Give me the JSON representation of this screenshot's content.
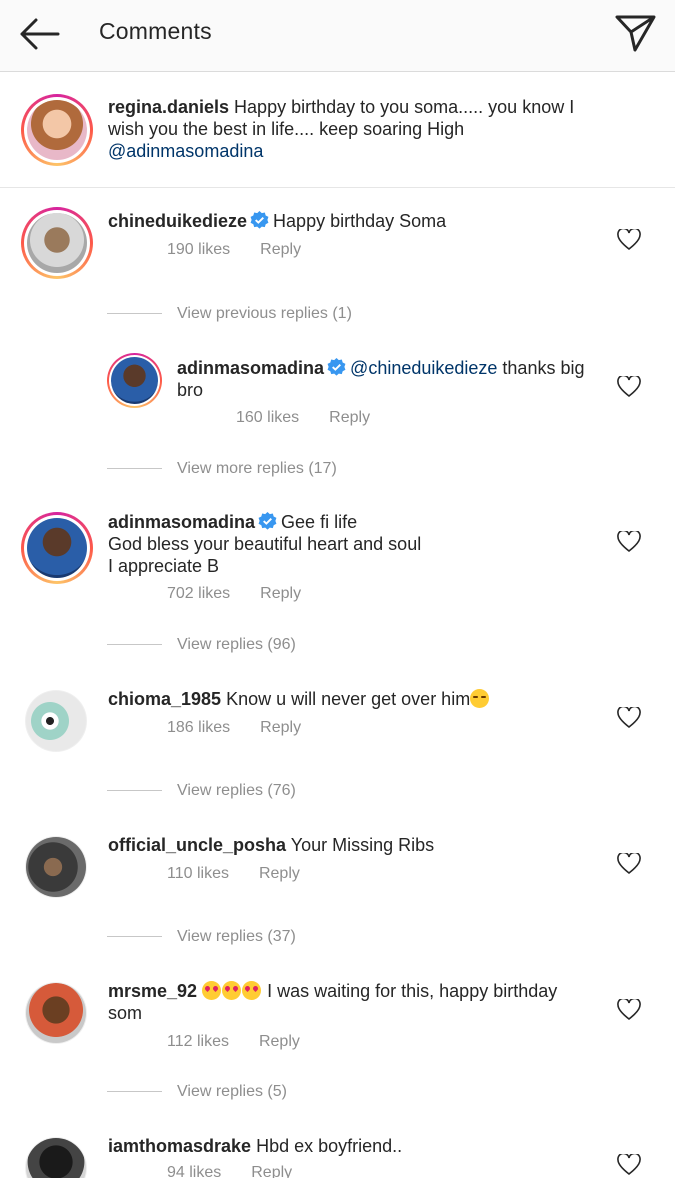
{
  "header": {
    "title": "Comments"
  },
  "caption": {
    "username": "regina.daniels",
    "text": " Happy birthday to you soma..... you know I wish you the best in life.... keep soaring High ",
    "mention": "@adinmasomadina"
  },
  "comments": [
    {
      "username": "chineduikedieze",
      "text": "Happy birthday Soma",
      "likes": "190 likes",
      "reply": "Reply"
    },
    {
      "view_replies": "View previous replies (1)"
    },
    {
      "username": "adinmasomadina",
      "mention": "@chineduikedieze",
      "text": " thanks big bro",
      "likes": "160 likes",
      "reply": "Reply"
    },
    {
      "view_replies": "View more replies (17)"
    },
    {
      "username": "adinmasomadina",
      "text_line1": "Gee fi life",
      "text_line2": "God bless your beautiful heart and soul",
      "text_line3": "I appreciate B",
      "likes": "702 likes",
      "reply": "Reply",
      "view_replies": "View replies (96)"
    },
    {
      "username": "chioma_1985",
      "text": " Know u will never get over him",
      "likes": "186 likes",
      "reply": "Reply",
      "view_replies": "View replies (76)"
    },
    {
      "username": "official_uncle_posha",
      "text": " Your Missing Ribs",
      "likes": "110 likes",
      "reply": "Reply",
      "view_replies": "View replies (37)"
    },
    {
      "username": "mrsme_92",
      "text": " I was waiting for this, happy birthday som",
      "likes": "112 likes",
      "reply": "Reply",
      "view_replies": "View replies (5)"
    },
    {
      "username": "iamthomasdrake",
      "text": " Hbd ex boyfriend..",
      "likes": "94 likes",
      "reply": "Reply"
    }
  ],
  "colors": {
    "link": "#003569",
    "meta": "#8e8e8e",
    "verified": "#3897f0"
  }
}
